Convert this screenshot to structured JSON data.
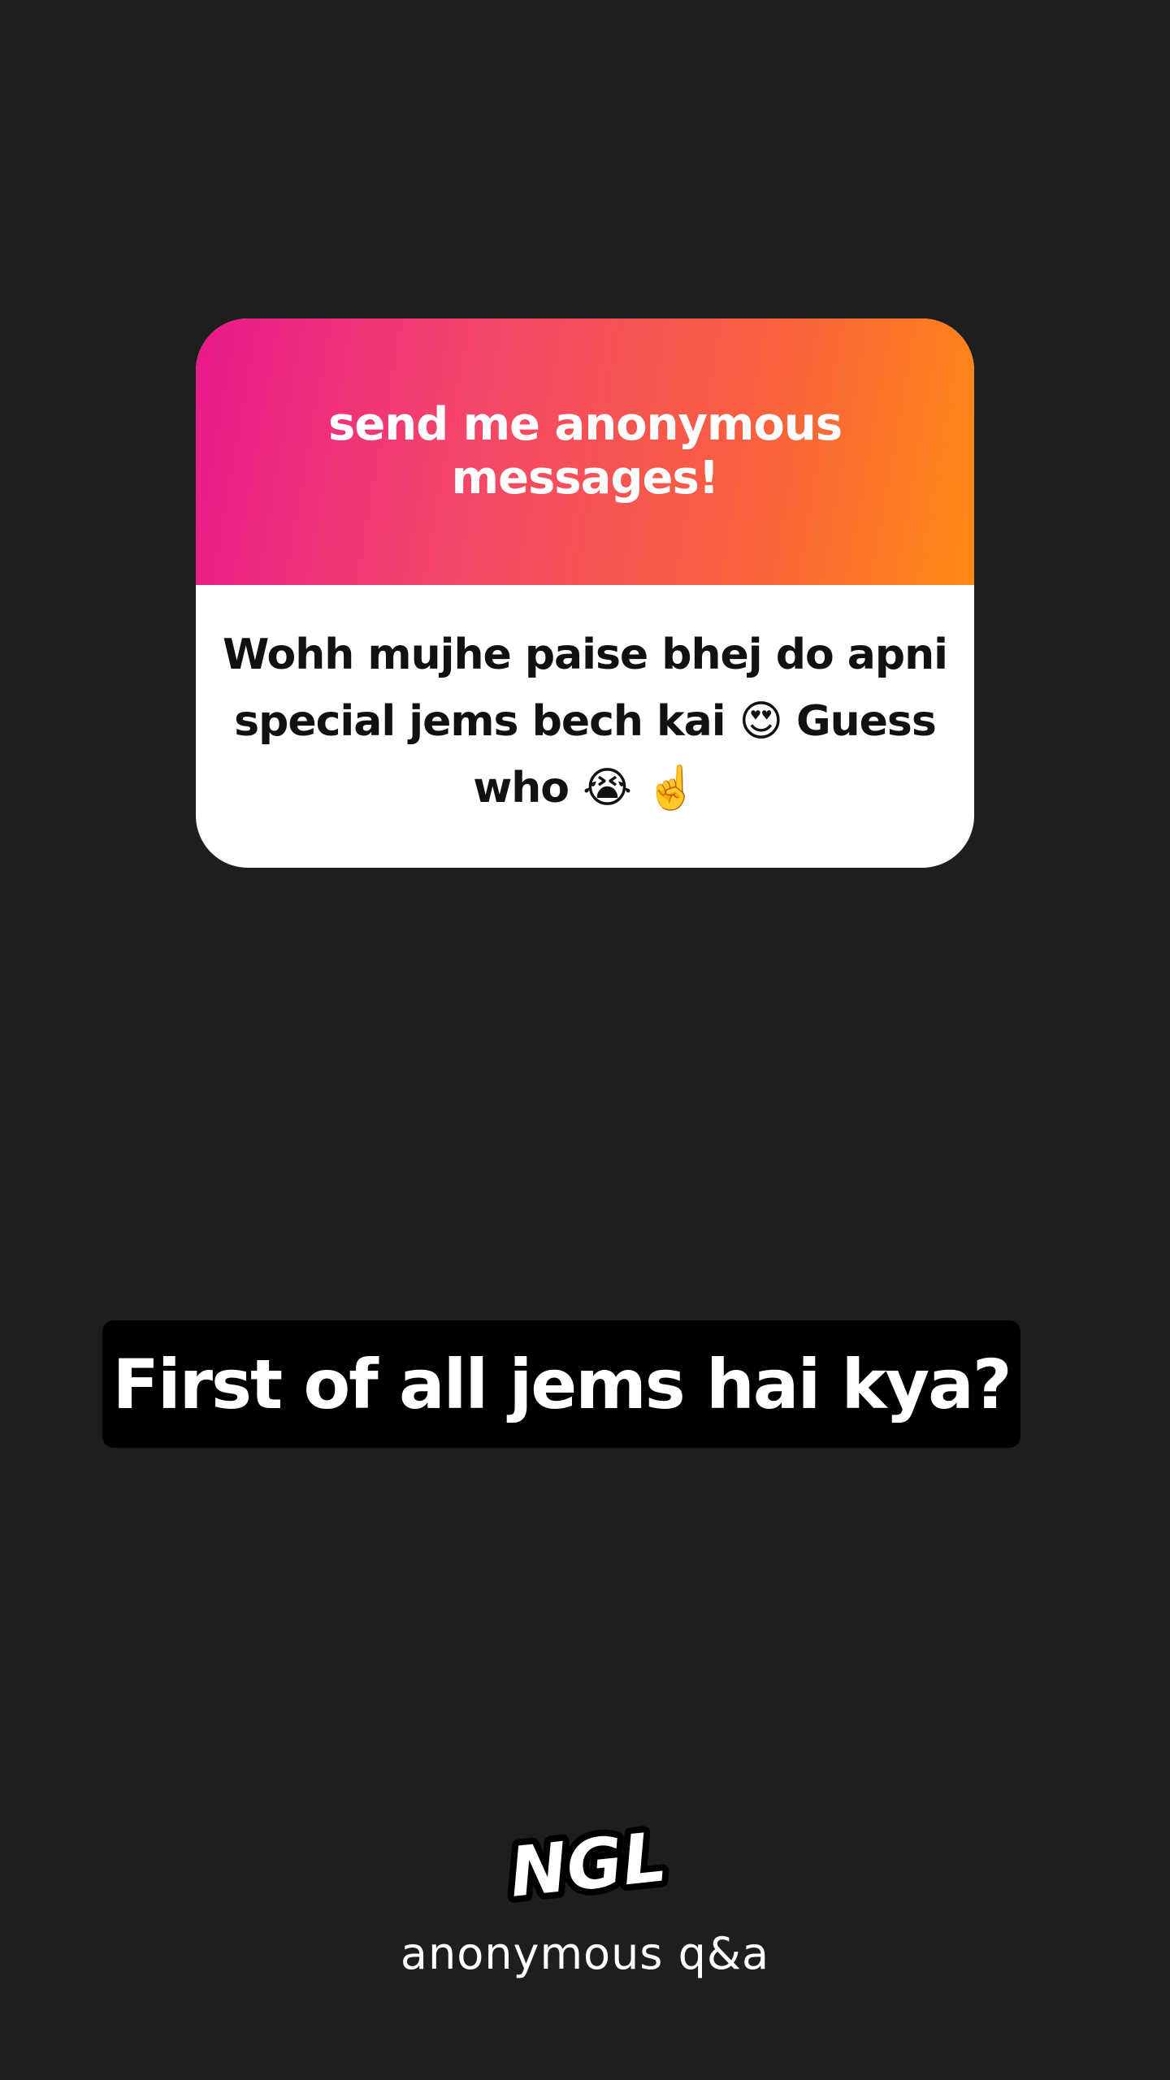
{
  "card": {
    "header": "send me anonymous messages!",
    "message": "Wohh mujhe paise bhej do apni special jems bech kai 😍 Guess who 😭 ☝️"
  },
  "caption": "First of all jems hai kya?",
  "branding": {
    "logo": "NGL",
    "tagline": "anonymous q&a"
  },
  "colors": {
    "background": "#1e1e1e",
    "gradient_start": "#e8198b",
    "gradient_end": "#ff8a14"
  }
}
